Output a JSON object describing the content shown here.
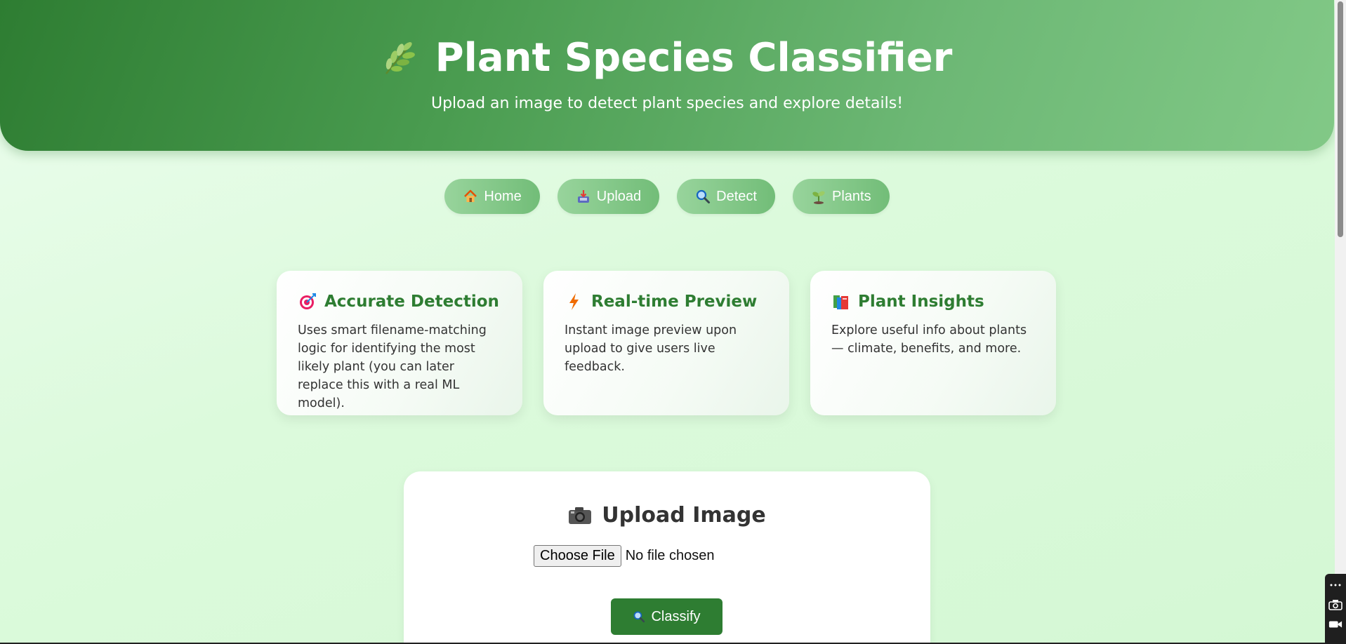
{
  "header": {
    "title": "Plant Species Classifier",
    "subtitle": "Upload an image to detect plant species and explore details!",
    "icon": "herb-icon"
  },
  "nav": {
    "items": [
      {
        "label": "Home",
        "icon": "house-icon"
      },
      {
        "label": "Upload",
        "icon": "inbox-tray-icon"
      },
      {
        "label": "Detect",
        "icon": "magnifier-icon"
      },
      {
        "label": "Plants",
        "icon": "seedling-icon"
      }
    ]
  },
  "features": [
    {
      "title": "Accurate Detection",
      "icon": "target-icon",
      "text": "Uses smart filename-matching logic for identifying the most likely plant (you can later replace this with a real ML model)."
    },
    {
      "title": "Real-time Preview",
      "icon": "lightning-icon",
      "text": "Instant image preview upon upload to give users live feedback."
    },
    {
      "title": "Plant Insights",
      "icon": "books-icon",
      "text": "Explore useful info about plants — climate, benefits, and more."
    }
  ],
  "upload": {
    "title": "Upload Image",
    "icon": "camera-icon",
    "choose_label": "Choose File",
    "file_status": "No file chosen",
    "classify_label": "Classify"
  },
  "colors": {
    "primary": "#2e7d32",
    "header_start": "#2e7d32",
    "header_end": "#82c987",
    "background": "#dcfadc"
  }
}
